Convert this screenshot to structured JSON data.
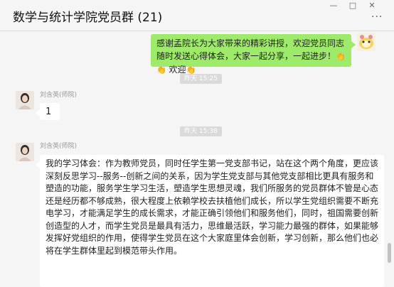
{
  "window": {
    "title": "数学与统计学院党员群 (21)",
    "minimize_glyph": "—",
    "maximize_glyph": "□",
    "close_glyph": "✕",
    "more_glyph": "···"
  },
  "messages": [
    {
      "type": "self",
      "text_before": "感谢孟院长为大家带来的精彩讲授，欢迎党员同志随时发送心得体会，大家一起分享，一起进步！",
      "claps": "👏👏",
      "text_after": "欢迎",
      "clap_end": "👏"
    },
    {
      "type": "timestamp",
      "text": "昨天 15:25"
    },
    {
      "type": "other",
      "sender": "刘含英(师院)",
      "text": "1"
    },
    {
      "type": "timestamp",
      "text": "昨天 15:38"
    },
    {
      "type": "other",
      "sender": "刘含英(师院)",
      "text": "我的学习体会：作为教师党员，同时任学生第一党支部书记，站在这个两个角度，更应该深刻反思学习--服务--创新之间的关系，因为学生党支部与其他党支部相比更具有服务和塑造的功能，服务学生学习生活，塑造学生思想灵魂，我们所服务的党员群体不管是心态还是经历都不够成熟，很大程度上依赖学校去扶植他们成长，所以学生党组织需要不断充电学习，才能满足学生的成长需求，才能正确引领他们和服务他们，同时，祖国需要创新创造型的人才，而学生党员是最具有活力，思维最活跃，学习能力最强的群体，如果能够发挥好党组织的作用，使得学生党员在这个大家庭里体会创新，学习创新，那么他们也必将在学生群体里起到模范带头作用。"
    }
  ],
  "colors": {
    "self_bubble": "#9eea6a",
    "other_bubble": "#ffffff",
    "background": "#f5f5f5",
    "timestamp_bg": "#dadada"
  }
}
